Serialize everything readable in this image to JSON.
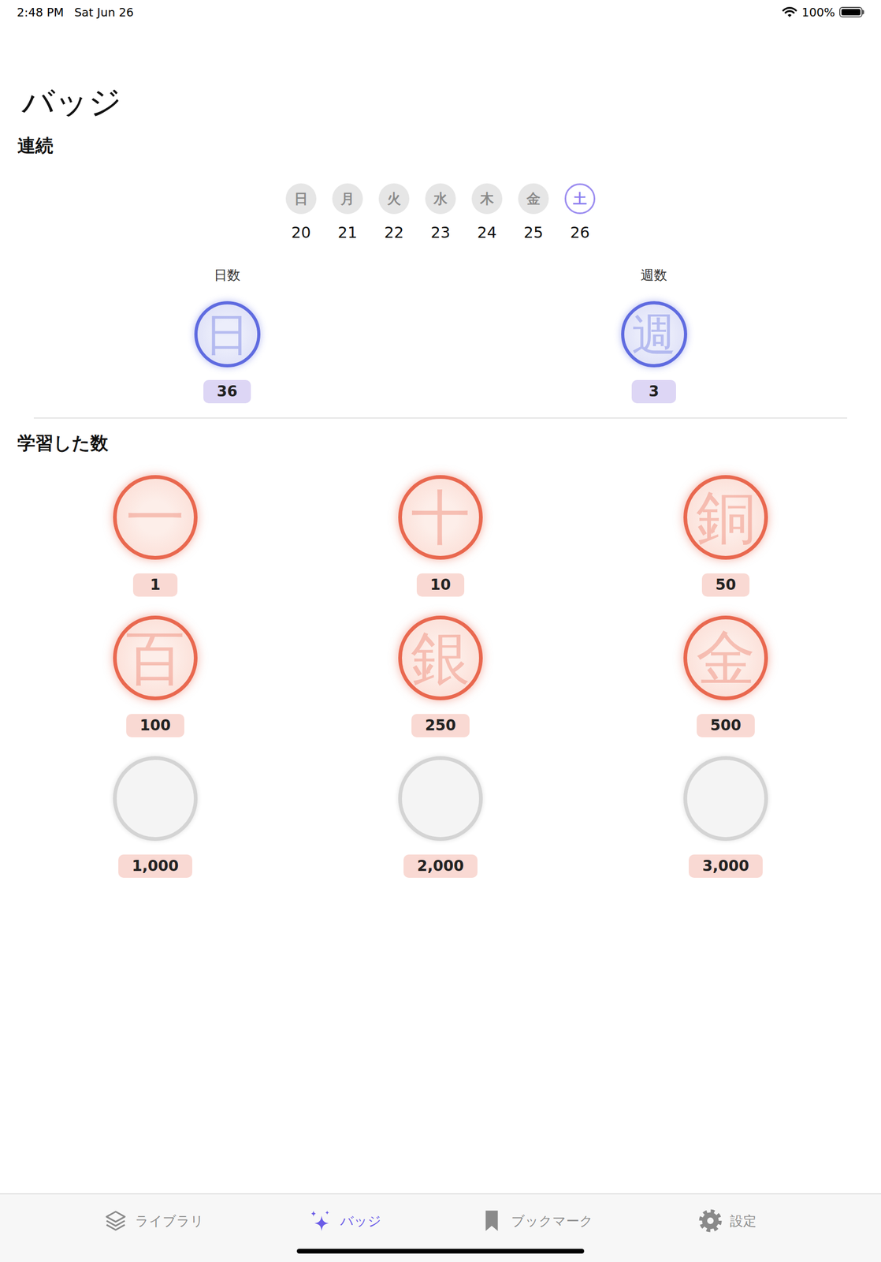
{
  "status_bar": {
    "time": "2:48 PM",
    "date": "Sat Jun 26",
    "battery": "100%",
    "battery_level": 1
  },
  "title": "バッジ",
  "streak": {
    "heading": "連続",
    "days": [
      {
        "weekday": "日",
        "date": "20",
        "selected": false
      },
      {
        "weekday": "月",
        "date": "21",
        "selected": false
      },
      {
        "weekday": "火",
        "date": "22",
        "selected": false
      },
      {
        "weekday": "水",
        "date": "23",
        "selected": false
      },
      {
        "weekday": "木",
        "date": "24",
        "selected": false
      },
      {
        "weekday": "金",
        "date": "25",
        "selected": false
      },
      {
        "weekday": "土",
        "date": "26",
        "selected": true
      }
    ],
    "counters": [
      {
        "label": "日数",
        "glyph": "日",
        "count": "36"
      },
      {
        "label": "週数",
        "glyph": "週",
        "count": "3"
      }
    ]
  },
  "learned": {
    "heading": "学習した数",
    "badges": [
      {
        "glyph": "一",
        "count": "1",
        "earned": true
      },
      {
        "glyph": "十",
        "count": "10",
        "earned": true
      },
      {
        "glyph": "銅",
        "count": "50",
        "earned": true
      },
      {
        "glyph": "百",
        "count": "100",
        "earned": true
      },
      {
        "glyph": "銀",
        "count": "250",
        "earned": true
      },
      {
        "glyph": "金",
        "count": "500",
        "earned": true
      },
      {
        "count": "1,000",
        "earned": false
      },
      {
        "count": "2,000",
        "earned": false
      },
      {
        "count": "3,000",
        "earned": false
      }
    ]
  },
  "tabs": [
    {
      "label": "ライブラリ",
      "selected": false
    },
    {
      "label": "バッジ",
      "selected": true
    },
    {
      "label": "ブックマーク",
      "selected": false
    },
    {
      "label": "設定",
      "selected": false
    }
  ]
}
